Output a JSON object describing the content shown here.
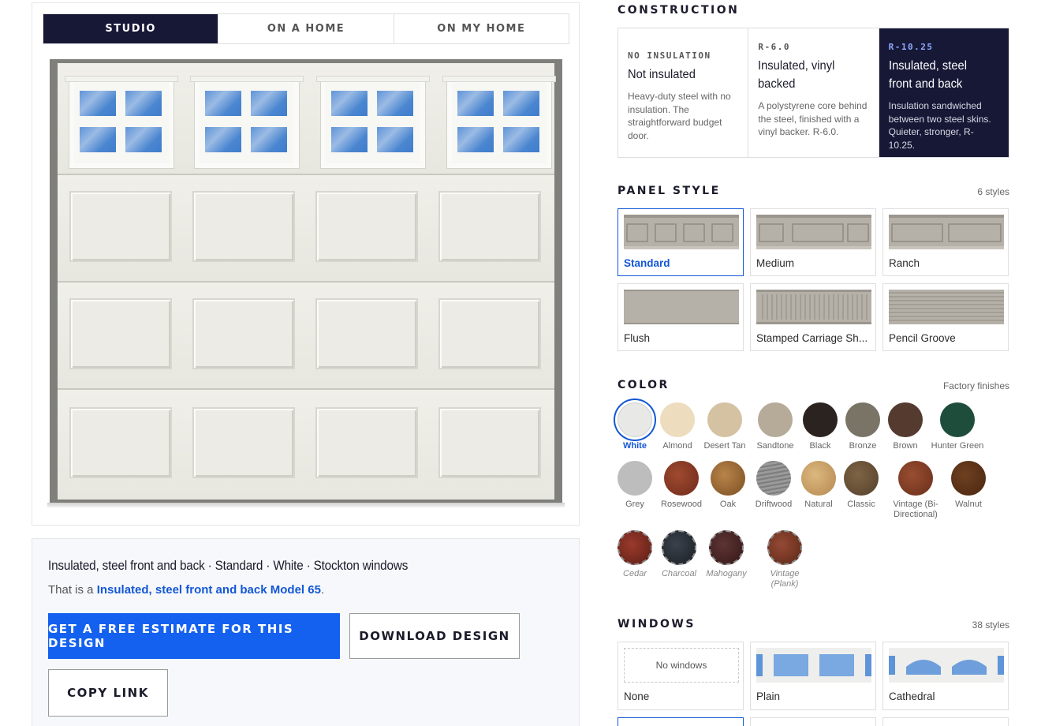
{
  "view_tabs": [
    "STUDIO",
    "ON A HOME",
    "ON MY HOME"
  ],
  "summary": {
    "title": "Insulated, steel front and back · Standard · White · Stockton windows",
    "sub_prefix": "That is a ",
    "model_link": "Insulated, steel front and back Model 65",
    "sub_suffix": ".",
    "estimate_button": "GET A FREE ESTIMATE FOR THIS DESIGN",
    "download_button": "DOWNLOAD DESIGN",
    "copy_button": "COPY LINK"
  },
  "construction": {
    "heading": "CONSTRUCTION",
    "options": [
      {
        "eyebrow": "NO INSULATION",
        "title": "Not insulated",
        "desc": "Heavy-duty steel with no insulation. The straightforward budget door.",
        "active": false
      },
      {
        "eyebrow": "R-6.0",
        "title": "Insulated, vinyl backed",
        "desc": "A polystyrene core behind the steel, finished with a vinyl backer. R-6.0.",
        "active": false
      },
      {
        "eyebrow": "R-10.25",
        "title": "Insulated, steel front and back",
        "desc": "Insulation sandwiched between two steel skins. Quieter, stronger, R-10.25.",
        "active": true
      }
    ]
  },
  "panel_style": {
    "heading": "PANEL STYLE",
    "meta": "6 styles",
    "options": [
      {
        "label": "Standard",
        "pattern": "standard",
        "active": true
      },
      {
        "label": "Medium",
        "pattern": "medium",
        "active": false
      },
      {
        "label": "Ranch",
        "pattern": "ranch",
        "active": false
      },
      {
        "label": "Flush",
        "pattern": "flush",
        "active": false
      },
      {
        "label": "Stamped Carriage Sh...",
        "pattern": "carriage",
        "active": false
      },
      {
        "label": "Pencil Groove",
        "pattern": "groove",
        "active": false
      }
    ]
  },
  "color": {
    "heading": "COLOR",
    "meta": "Factory finishes",
    "options": [
      {
        "label": "White",
        "hex": "#e8e8e6",
        "active": true,
        "special": false
      },
      {
        "label": "Almond",
        "hex": "#eddcbd",
        "active": false,
        "special": false
      },
      {
        "label": "Desert Tan",
        "hex": "#d4c2a2",
        "active": false,
        "special": false
      },
      {
        "label": "Sandtone",
        "hex": "#b6ab99",
        "active": false,
        "special": false
      },
      {
        "label": "Black",
        "hex": "#2a2320",
        "active": false,
        "special": false
      },
      {
        "label": "Bronze",
        "hex": "#7a7466",
        "active": false,
        "special": false
      },
      {
        "label": "Brown",
        "hex": "#553a30",
        "active": false,
        "special": false
      },
      {
        "label": "Hunter Green",
        "hex": "#1f4d3c",
        "active": false,
        "special": false
      },
      {
        "label": "Grey",
        "hex": "#bdbdbd",
        "active": false,
        "special": false
      },
      {
        "label": "Rosewood",
        "hex": "#8a3a26",
        "active": false,
        "special": false
      },
      {
        "label": "Oak",
        "hex": "#9a6a38",
        "active": false,
        "special": false
      },
      {
        "label": "Driftwood",
        "hex": "#8c8c8c",
        "active": false,
        "special": false
      },
      {
        "label": "Natural",
        "hex": "#caa46c",
        "active": false,
        "special": false
      },
      {
        "label": "Classic",
        "hex": "#6a5238",
        "active": false,
        "special": false
      },
      {
        "label": "Vintage (Bi-Directional)",
        "hex": "#7c3e26",
        "active": false,
        "special": false
      },
      {
        "label": "Walnut",
        "hex": "#5a3217",
        "active": false,
        "special": false
      },
      {
        "label": "Cedar",
        "hex": "#7c2e24",
        "active": false,
        "special": true
      },
      {
        "label": "Charcoal",
        "hex": "#2a3038",
        "active": false,
        "special": true
      },
      {
        "label": "Mahogany",
        "hex": "#4a2a2a",
        "active": false,
        "special": true
      },
      {
        "label": "Vintage (Plank)",
        "hex": "#7c3e2e",
        "active": false,
        "special": true
      }
    ]
  },
  "windows": {
    "heading": "WINDOWS",
    "meta": "38 styles",
    "options": [
      {
        "label": "None",
        "swatch_text": "No windows",
        "pattern": "none"
      },
      {
        "label": "Plain",
        "swatch_text": "",
        "pattern": "plain"
      },
      {
        "label": "Cathedral",
        "swatch_text": "",
        "pattern": "cathedral"
      }
    ]
  },
  "colors": {
    "accent": "#1461f0",
    "link": "#1357d6",
    "navy": "#171836"
  }
}
